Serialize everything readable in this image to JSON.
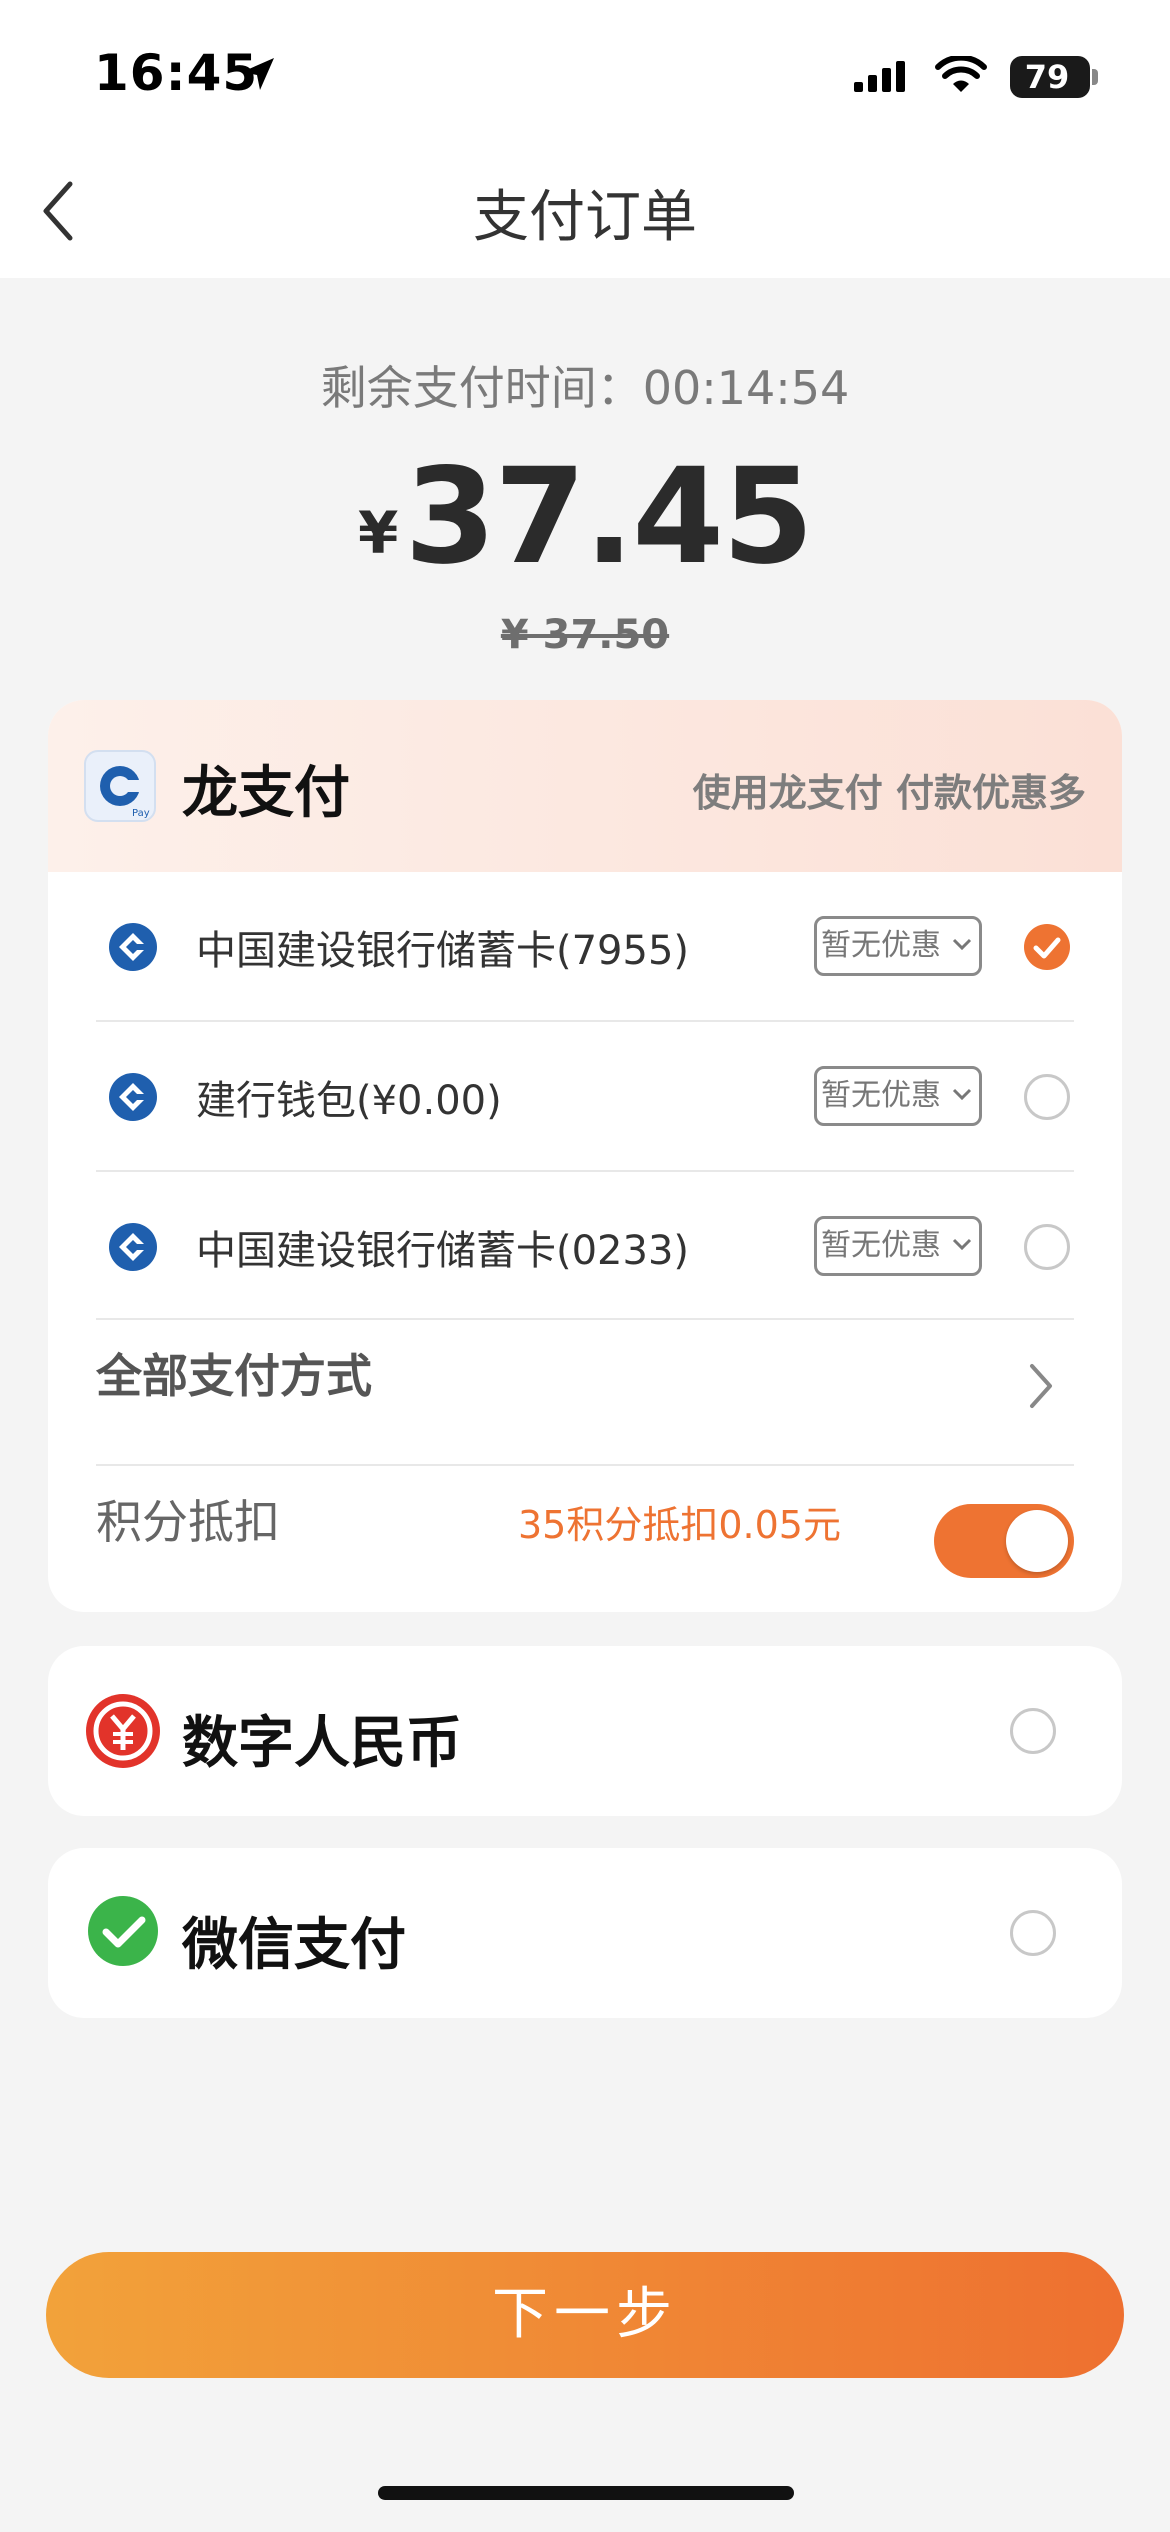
{
  "status_bar": {
    "time": "16:45",
    "battery": "79"
  },
  "header": {
    "title": "支付订单"
  },
  "payment": {
    "countdown": "剩余支付时间：00:14:54",
    "currency": "¥",
    "amount": "37.45",
    "original_amount": "¥ 37.50"
  },
  "longpay": {
    "title": "龙支付",
    "promo": "使用龙支付 付款优惠多",
    "options": [
      {
        "label": "中国建设银行储蓄卡(7955)",
        "promo": "暂无优惠",
        "selected": true
      },
      {
        "label": "建行钱包(¥0.00)",
        "promo": "暂无优惠",
        "selected": false
      },
      {
        "label": "中国建设银行储蓄卡(0233)",
        "promo": "暂无优惠",
        "selected": false
      }
    ],
    "all_methods": "全部支付方式",
    "points_label": "积分抵扣",
    "points_value": "35积分抵扣0.05元",
    "points_enabled": true
  },
  "methods": [
    {
      "title": "数字人民币",
      "icon": "digital-rmb-icon",
      "selected": false
    },
    {
      "title": "微信支付",
      "icon": "wechat-pay-icon",
      "selected": false
    }
  ],
  "next_button": "下一步",
  "colors": {
    "accent": "#ee7332",
    "gradient_start": "#f2a23a",
    "gradient_end": "#ee7030"
  }
}
